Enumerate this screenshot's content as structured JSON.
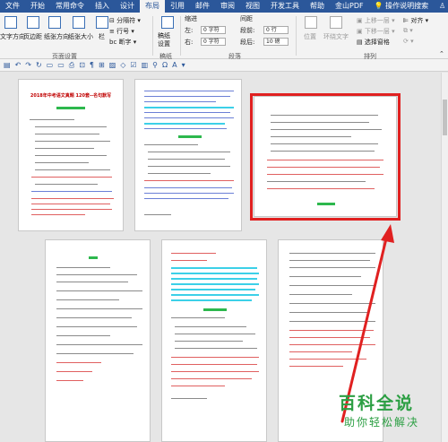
{
  "menu": {
    "items": [
      "文件",
      "开始",
      "常用命令",
      "插入",
      "设计",
      "布局",
      "引用",
      "邮件",
      "审阅",
      "视图",
      "开发工具",
      "帮助",
      "金山PDF"
    ],
    "active_index": 5,
    "tell_me": "操作说明搜索",
    "share": "共享"
  },
  "ribbon": {
    "text_direction": "文字方向",
    "margins": "页边距",
    "orientation": "纸张方向",
    "size": "纸张大小",
    "columns": "栏",
    "breaks": "分隔符",
    "line_numbers": "行号",
    "hyphenation": "断字",
    "page_setup_group": "页面设置",
    "draft_settings": "稿纸设置",
    "draft_group": "稿纸",
    "indent_label": "缩进",
    "spacing_label": "间距",
    "indent_left": "左:",
    "indent_right": "右:",
    "indent_left_value": "0 字符",
    "indent_right_value": "0 字符",
    "spacing_before": "段前:",
    "spacing_after": "段后:",
    "spacing_before_value": "0 行",
    "spacing_after_value": "10 磅",
    "paragraph_group": "段落",
    "position": "位置",
    "wrap_text": "环绕文字",
    "bring_forward": "上移一层",
    "send_backward": "下移一层",
    "selection_pane": "选择窗格",
    "align": "对齐",
    "arrange_group": "排列"
  },
  "pages": {
    "page1_title": "2018年中考语文真题 120套--名句默写"
  },
  "watermark": {
    "title": "百科全说",
    "subtitle": "助你轻松解决"
  },
  "colors": {
    "ribbon_blue": "#2b579a",
    "highlight_red": "#e02020",
    "watermark_green": "#2c9f43"
  }
}
